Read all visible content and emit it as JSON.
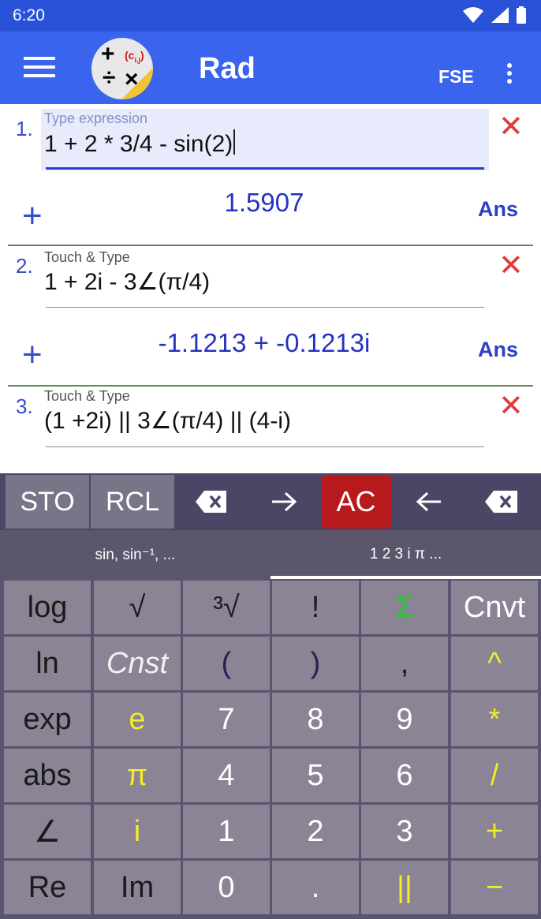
{
  "status_bar": {
    "time": "6:20",
    "icons": [
      "wifi-icon",
      "signal-icon",
      "battery-icon"
    ]
  },
  "app_bar": {
    "logo_text": "c i,j",
    "mode": "Rad",
    "format": "FSE",
    "colors": {
      "background": "#3a64ee",
      "status": "#2a52d8"
    }
  },
  "entries": [
    {
      "number": "1.",
      "hint": "Type expression",
      "expression": "1 + 2 * 3/4 - sin(2)",
      "result": "1.5907",
      "ans_label": "Ans",
      "active": true
    },
    {
      "number": "2.",
      "hint": "Touch & Type",
      "expression": "1 + 2i - 3∠(π/4)",
      "result": "-1.1213 + -0.1213i",
      "ans_label": "Ans",
      "active": false
    },
    {
      "number": "3.",
      "hint": "Touch & Type",
      "expression": "(1 +2i) || 3∠(π/4) || (4-i)",
      "active": false
    }
  ],
  "keyboard_top": {
    "sto": "STO",
    "rcl": "RCL",
    "ac": "AC",
    "icons": [
      "clear-field-icon",
      "arrow-right-icon",
      "arrow-left-icon",
      "backspace-icon"
    ]
  },
  "keyboard_tabs": [
    {
      "label": "sin, sin⁻¹, ...",
      "selected": false
    },
    {
      "label": "1 2 3 i π ...",
      "selected": true
    }
  ],
  "keys": [
    [
      "log",
      "√",
      "³√",
      "!",
      "Σ",
      "Cnvt"
    ],
    [
      "ln",
      "Cnst",
      "(",
      ")",
      ",",
      "^"
    ],
    [
      "exp",
      "e",
      "7",
      "8",
      "9",
      "*"
    ],
    [
      "abs",
      "π",
      "4",
      "5",
      "6",
      "/"
    ],
    [
      "∠",
      "i",
      "1",
      "2",
      "3",
      "+"
    ],
    [
      "Re",
      "Im",
      "0",
      ".",
      "||",
      "−"
    ]
  ]
}
